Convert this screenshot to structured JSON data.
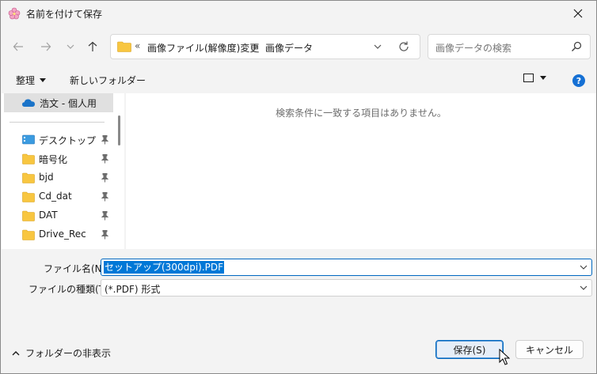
{
  "window": {
    "title": "名前を付けて保存",
    "close_glyph": "✕"
  },
  "address": {
    "overflow": "«",
    "segments": [
      "画像ファイル(解像度)変更",
      "画像データ"
    ],
    "separator": "›"
  },
  "search": {
    "placeholder": "画像データの検索"
  },
  "toolbar": {
    "organize_label": "整理",
    "new_folder_label": "新しいフォルダー",
    "help_glyph": "?"
  },
  "nav": {
    "onedrive_label": "浩文 - 個人用",
    "items": [
      {
        "label": "デスクトップ",
        "icon": "desktop-icon"
      },
      {
        "label": "暗号化",
        "icon": "folder-icon"
      },
      {
        "label": "bjd",
        "icon": "folder-icon"
      },
      {
        "label": "Cd_dat",
        "icon": "folder-icon"
      },
      {
        "label": "DAT",
        "icon": "folder-icon"
      },
      {
        "label": "Drive_Rec",
        "icon": "folder-icon"
      }
    ]
  },
  "content": {
    "empty_message": "検索条件に一致する項目はありません。"
  },
  "form": {
    "filename_label": "ファイル名(N):",
    "filename_value": "セットアップ(300dpi).PDF",
    "filetype_label": "ファイルの種類(T):",
    "filetype_value": "(*.PDF) 形式"
  },
  "footer": {
    "hide_folders_label": "フォルダーの非表示",
    "save_label": "保存(S)",
    "cancel_label": "キャンセル"
  },
  "colors": {
    "accent": "#0067c0",
    "selection": "#0078d7",
    "folder": "#f8c640",
    "help": "#1570d4"
  }
}
